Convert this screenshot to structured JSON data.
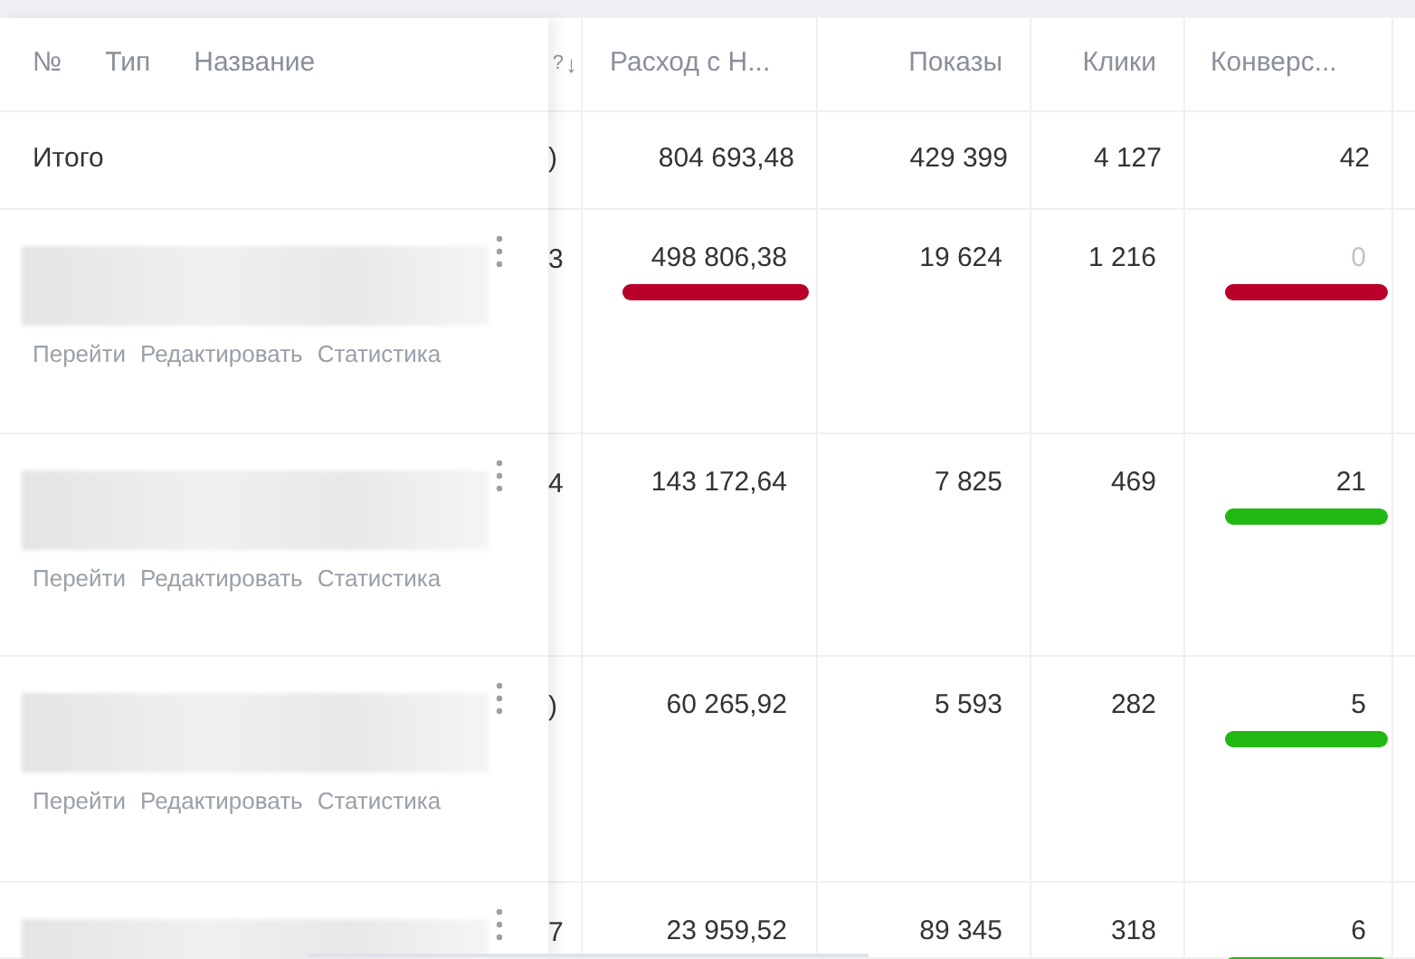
{
  "header": {
    "number": "№",
    "type": "Тип",
    "name": "Название",
    "column_1": "?",
    "sort_arrow": "↓",
    "spend": "Расход с Н...",
    "impressions": "Показы",
    "clicks": "Клики",
    "conversions": "Конверс..."
  },
  "total": {
    "label": "Итого",
    "column_1": ")",
    "spend": "804 693,48",
    "impressions": "429 399",
    "clicks": "4 127",
    "conversions": "42"
  },
  "rows": [
    {
      "links": [
        "Перейти",
        "Редактировать",
        "Статистика"
      ],
      "column_1": "3",
      "spend": {
        "value": "498 806,38",
        "color": "#b8002a"
      },
      "impressions": "19 624",
      "clicks": "1 216",
      "conversions": {
        "value": "0",
        "muted": true,
        "color": "#b8002a"
      }
    },
    {
      "links": [
        "Перейти",
        "Редактировать",
        "Статистика"
      ],
      "column_1": "4",
      "spend": {
        "value": "143 172,64"
      },
      "impressions": "7 825",
      "clicks": "469",
      "conversions": {
        "value": "21",
        "muted": false,
        "color": "#22b814"
      }
    },
    {
      "links": [
        "Перейти",
        "Редактировать",
        "Статистика"
      ],
      "column_1": ")",
      "spend": {
        "value": "60 265,92"
      },
      "impressions": "5 593",
      "clicks": "282",
      "conversions": {
        "value": "5",
        "muted": false,
        "color": "#22b814"
      }
    },
    {
      "column_1": "7",
      "spend": {
        "value": "23 959,52"
      },
      "impressions": "89 345",
      "clicks": "318",
      "conversions": {
        "value": "6",
        "muted": false,
        "color": "#22b814"
      }
    }
  ]
}
